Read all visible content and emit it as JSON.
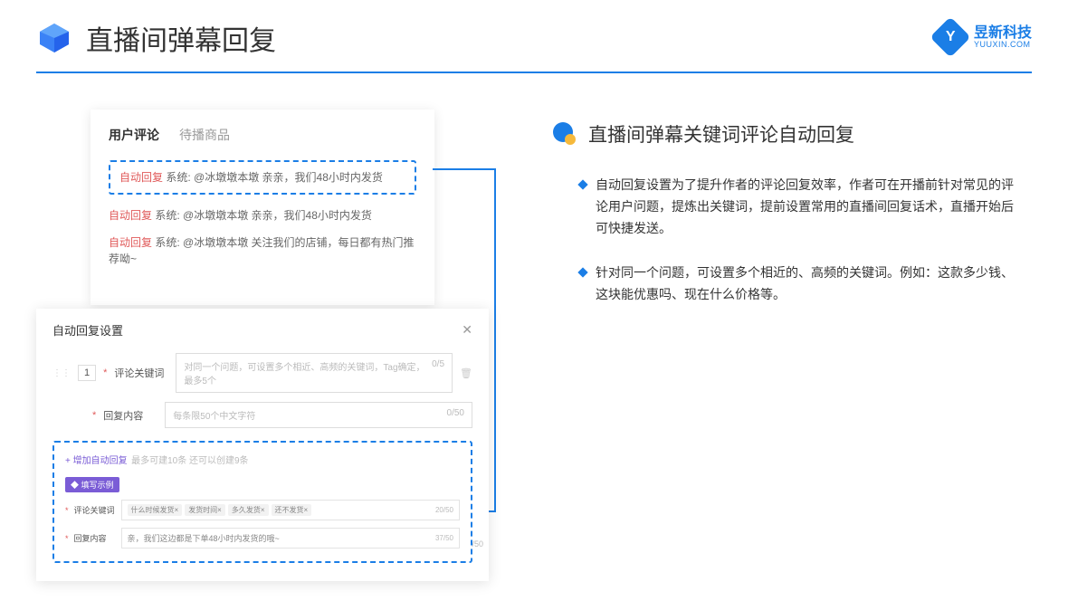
{
  "header": {
    "title": "直播间弹幕回复"
  },
  "brand": {
    "cn": "昱新科技",
    "en": "YUUXIN.COM"
  },
  "card1": {
    "tab_active": "用户评论",
    "tab_inactive": "待播商品",
    "c1_tag": "自动回复",
    "c1_text": " 系统: @冰墩墩本墩 亲亲，我们48小时内发货",
    "c2_tag": "自动回复",
    "c2_text": " 系统: @冰墩墩本墩 亲亲，我们48小时内发货",
    "c3_tag": "自动回复",
    "c3_text": " 系统: @冰墩墩本墩 关注我们的店铺，每日都有热门推荐呦~"
  },
  "card2": {
    "title": "自动回复设置",
    "num": "1",
    "label1": "评论关键词",
    "ph1": "对同一个问题，可设置多个相近、高频的关键词，Tag确定，最多5个",
    "cnt1": "0/5",
    "label2": "回复内容",
    "ph2": "每条限50个中文字符",
    "cnt2": "0/50",
    "addlink": "+ 增加自动回复",
    "addhint": "最多可建10条 还可以创建9条",
    "badge": "◆ 填写示例",
    "ex_label1": "评论关键词",
    "ex_chip1": "什么时候发货×",
    "ex_chip2": "发货时间×",
    "ex_chip3": "多久发货×",
    "ex_chip4": "还不发货×",
    "ex_cnt1": "20/50",
    "ex_label2": "回复内容",
    "ex_text2": "亲，我们这边都是下单48小时内发货的哦~",
    "ex_cnt2": "37/50",
    "extra": "/50"
  },
  "right": {
    "title": "直播间弹幕关键词评论自动回复",
    "b1": "自动回复设置为了提升作者的评论回复效率，作者可在开播前针对常见的评论用户问题，提炼出关键词，提前设置常用的直播间回复话术，直播开始后可快捷发送。",
    "b2": "针对同一个问题，可设置多个相近的、高频的关键词。例如：这款多少钱、这块能优惠吗、现在什么价格等。"
  }
}
